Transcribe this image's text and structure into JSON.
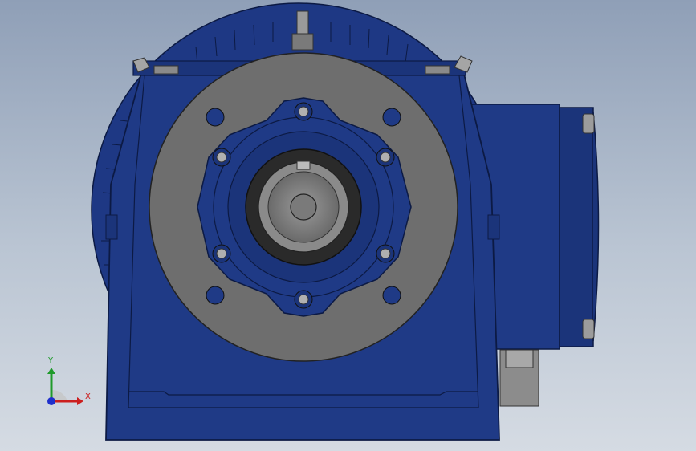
{
  "viewport": {
    "background_top": "#8f9fb7",
    "background_bottom": "#d5dbe3"
  },
  "model": {
    "name": "gear-reducer-motor",
    "view": "front",
    "housing_color": "#1f3a86",
    "housing_dark": "#15285e",
    "flange_color": "#6e6e6e",
    "shaft_color": "#8a8a8a",
    "bolt_count_outer": 4,
    "bolt_count_inner": 6
  },
  "triad": {
    "x_label": "X",
    "y_label": "Y",
    "x_color": "#cc1f1f",
    "y_color": "#1f9a2b",
    "z_color": "#1f2fcc"
  }
}
